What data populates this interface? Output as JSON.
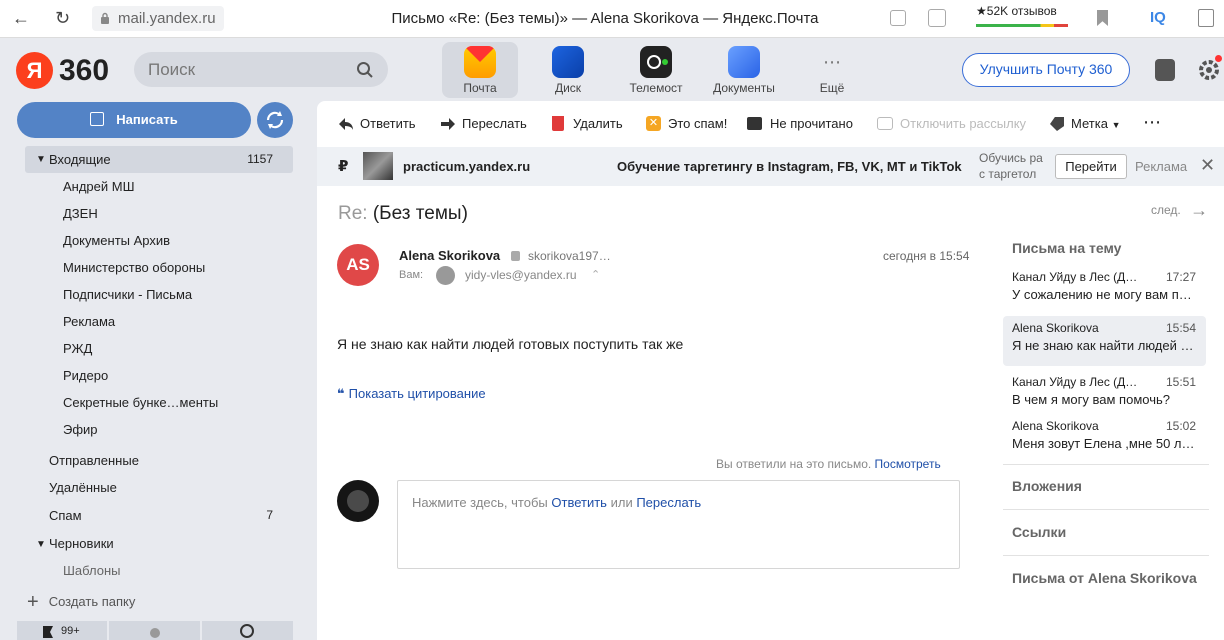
{
  "browser": {
    "url": "mail.yandex.ru",
    "title": "Письмо «Re: (Без темы)» — Alena Skorikova — Яндекс.Почта",
    "reviews": "52K отзывов"
  },
  "header": {
    "logo_letter": "Я",
    "logo_text": "360",
    "search_placeholder": "Поиск",
    "apps": [
      {
        "label": "Почта"
      },
      {
        "label": "Диск"
      },
      {
        "label": "Телемост"
      },
      {
        "label": "Документы"
      },
      {
        "label": "Ещё"
      }
    ],
    "upgrade_label": "Улучшить Почту 360"
  },
  "sidebar": {
    "compose_label": "Написать",
    "inbox": {
      "label": "Входящие",
      "count": "1157"
    },
    "subfolders": [
      "Андрей МШ",
      "ДЗЕН",
      "Документы Архив",
      "Министерство обороны",
      "Подписчики - Письма",
      "Реклама",
      "РЖД",
      "Ридеро",
      "Секретные бунке…менты",
      "Эфир"
    ],
    "sent": "Отправленные",
    "deleted": "Удалённые",
    "spam": {
      "label": "Спам",
      "count": "7"
    },
    "drafts": "Черновики",
    "templates": "Шаблоны",
    "create_folder": "Создать папку",
    "footer_badge": "99+"
  },
  "toolbar": {
    "reply": "Ответить",
    "forward": "Переслать",
    "delete": "Удалить",
    "spam": "Это спам!",
    "unread": "Не прочитано",
    "unsubscribe": "Отключить рассылку",
    "label": "Метка"
  },
  "ad": {
    "domain": "practicum.yandex.ru",
    "title": "Обучение таргетингу в Instagram, FB, VK, MT и TikTok",
    "desc_line1": "Обучись ра",
    "desc_line2": "с таргетол",
    "go_button": "Перейти",
    "ad_label": "Реклама"
  },
  "message": {
    "subject_prefix": "Re:",
    "subject": "(Без темы)",
    "next_label": "след.",
    "sender_initials": "AS",
    "sender_name": "Alena Skorikova",
    "sender_email": "skorikova197…",
    "time": "сегодня в 15:54",
    "to_label": "Вам:",
    "to_email": "yidy-vles@yandex.ru",
    "body": "Я не знаю как найти людей готовых поступить так же",
    "show_quote": "Показать цитирование",
    "replied_text": "Вы ответили на это письмо.",
    "replied_link": "Посмотреть",
    "reply_prompt_1": "Нажмите здесь, чтобы",
    "reply_link": "Ответить",
    "reply_prompt_or": "или",
    "forward_link": "Переслать"
  },
  "right_panel": {
    "thread_title": "Письма на тему",
    "threads": [
      {
        "from": "Канал Уйду в Лес (Д…",
        "time": "17:27",
        "snippet": "У сожалению не могу вам п…"
      },
      {
        "from": "Alena Skorikova",
        "time": "15:54",
        "snippet": "Я не знаю как найти людей …"
      },
      {
        "from": "Канал Уйду в Лес (Д…",
        "time": "15:51",
        "snippet": "В чем я могу вам помочь?"
      },
      {
        "from": "Alena Skorikova",
        "time": "15:02",
        "snippet": "Меня зовут Елена ,мне 50 л…"
      }
    ],
    "attachments": "Вложения",
    "links": "Ссылки",
    "from_sender": "Письма от Alena Skorikova"
  }
}
